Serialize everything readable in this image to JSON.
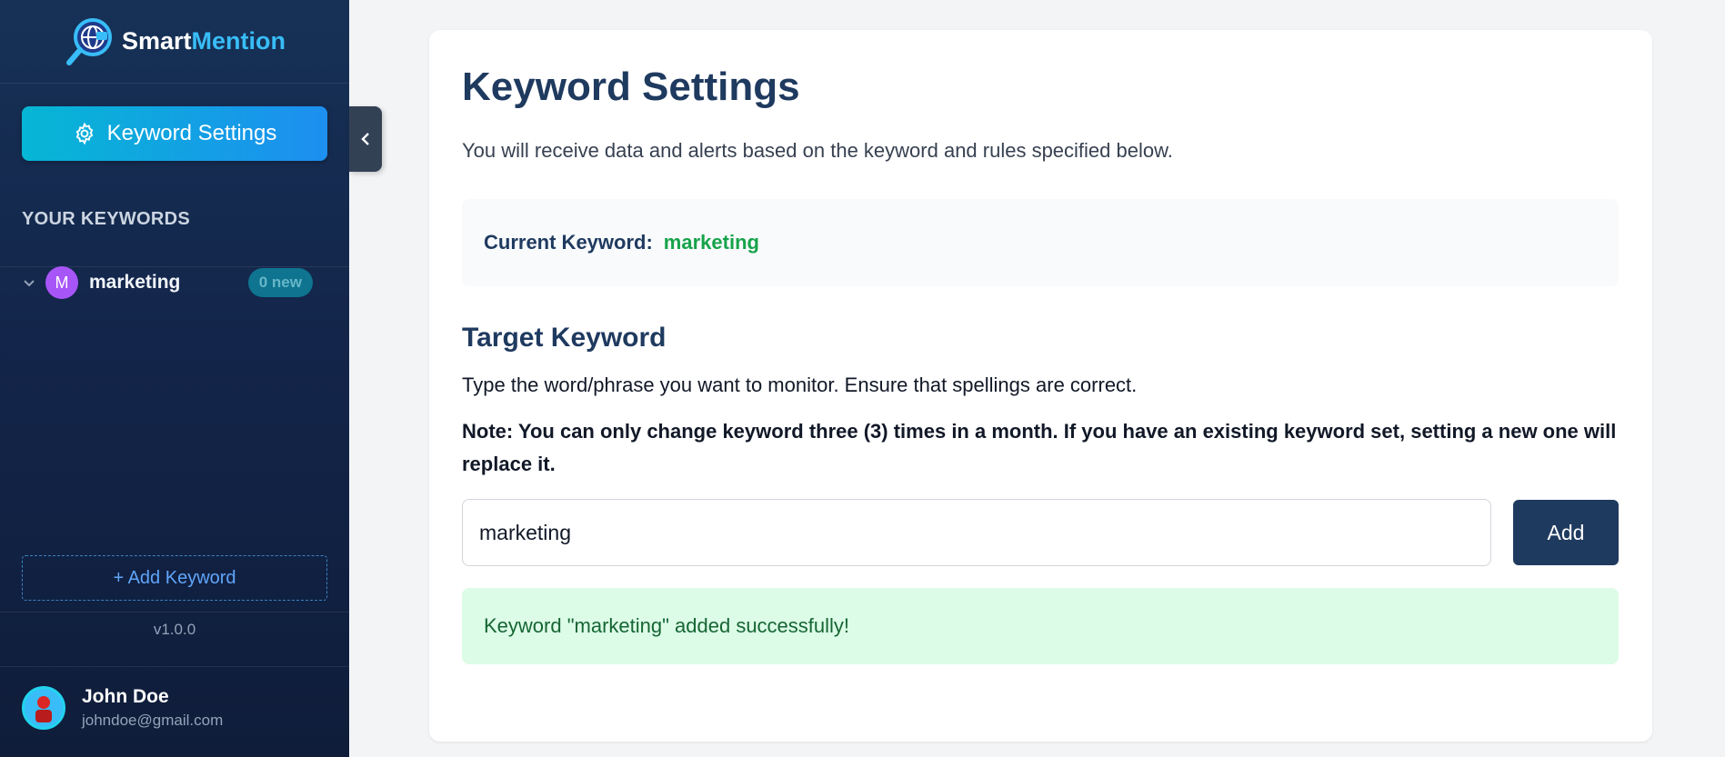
{
  "brand": {
    "name_part1": "Smart",
    "name_part2": "Mention",
    "icon": "globe-search-icon"
  },
  "sidebar": {
    "nav_button_label": "Keyword Settings",
    "section_title": "YOUR KEYWORDS",
    "keywords": [
      {
        "avatar_letter": "M",
        "label": "marketing",
        "badge": "0 new"
      }
    ],
    "add_keyword_label": "+ Add Keyword",
    "version": "v1.0.0"
  },
  "user": {
    "name": "John Doe",
    "email": "johndoe@gmail.com"
  },
  "main": {
    "title": "Keyword Settings",
    "description": "You will receive data and alerts based on the keyword and rules specified below.",
    "current_keyword_label": "Current Keyword:",
    "current_keyword_value": "marketing",
    "section_title": "Target Keyword",
    "help_text": "Type the word/phrase you want to monitor. Ensure that spellings are correct.",
    "note": "Note: You can only change keyword three (3) times in a month. If you have an existing keyword set, setting a new one will replace it.",
    "input_value": "marketing",
    "add_button_label": "Add",
    "success_message": "Keyword \"marketing\" added successfully!"
  },
  "colors": {
    "sidebar_bg": "#13254a",
    "accent": "#38bdf8",
    "primary": "#1f3a5f",
    "success_bg": "#dcfce7",
    "success_text": "#166534",
    "keyword_green": "#16a34a"
  }
}
